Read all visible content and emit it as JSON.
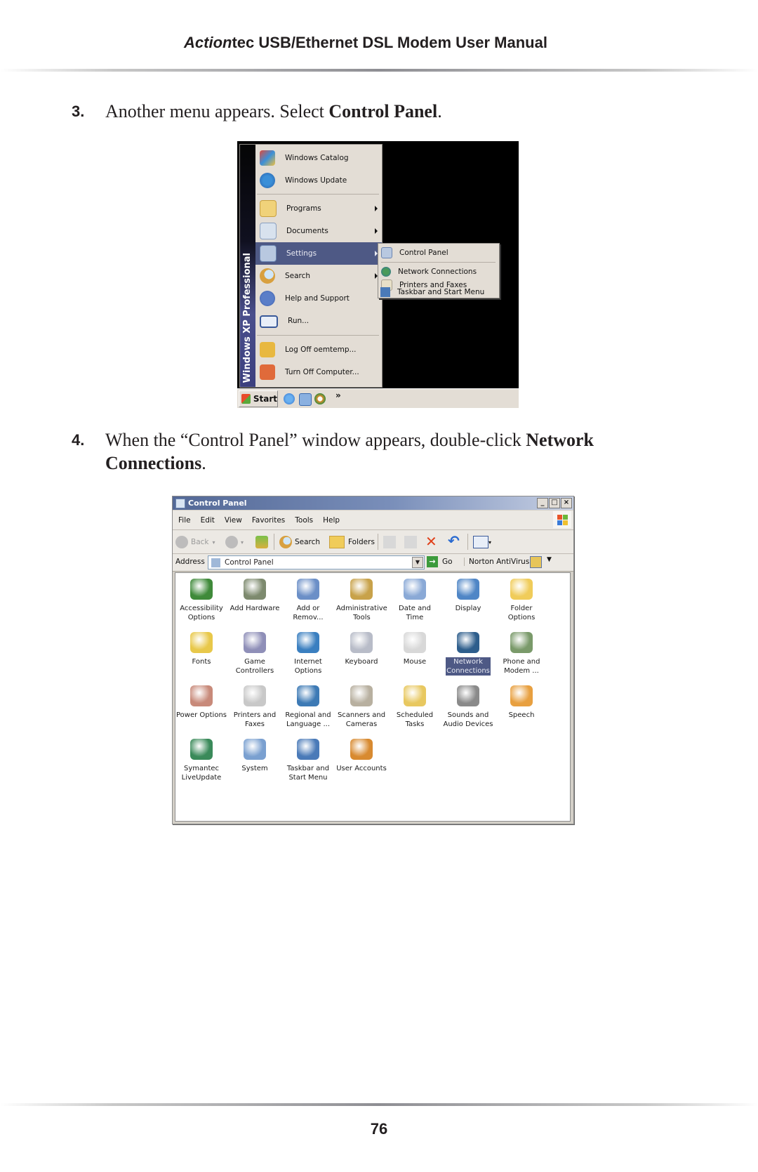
{
  "header": {
    "brand_italic": "Action",
    "title_rest": "tec USB/Ethernet DSL Modem User Manual"
  },
  "steps": [
    {
      "number": "3.",
      "text_before": "Another menu appears. Select ",
      "bold": "Control Panel",
      "text_after": "."
    },
    {
      "number": "4.",
      "text_before": "When the “Control Panel” window appears, double-click ",
      "bold": "Network Connections",
      "text_after": "."
    }
  ],
  "start_menu_screenshot": {
    "band_label": "Windows XP Professional",
    "items": [
      {
        "label": "Windows Catalog",
        "icon": "windows-catalog-icon",
        "submenu": false
      },
      {
        "label": "Windows Update",
        "icon": "windows-update-icon",
        "submenu": false
      },
      {
        "label": "Programs",
        "icon": "programs-icon",
        "submenu": true
      },
      {
        "label": "Documents",
        "icon": "documents-icon",
        "submenu": true
      },
      {
        "label": "Settings",
        "icon": "settings-icon",
        "submenu": true,
        "highlighted": true
      },
      {
        "label": "Search",
        "icon": "search-icon",
        "submenu": true
      },
      {
        "label": "Help and Support",
        "icon": "help-icon",
        "submenu": false
      },
      {
        "label": "Run...",
        "icon": "run-icon",
        "submenu": false
      },
      {
        "label": "Log Off oemtemp...",
        "icon": "log-off-icon",
        "submenu": false
      },
      {
        "label": "Turn Off Computer...",
        "icon": "power-icon",
        "submenu": false
      }
    ],
    "settings_submenu": [
      {
        "label": "Control Panel",
        "icon": "control-panel-icon"
      },
      {
        "label": "Network Connections",
        "icon": "network-connections-icon"
      },
      {
        "label": "Printers and Faxes",
        "icon": "printers-icon"
      },
      {
        "label": "Taskbar and Start Menu",
        "icon": "taskbar-icon"
      }
    ],
    "taskbar": {
      "start_label": "Start",
      "chevron": "»"
    }
  },
  "control_panel_screenshot": {
    "window_title": "Control Panel",
    "window_buttons": [
      "_",
      "□",
      "×"
    ],
    "menu": [
      "File",
      "Edit",
      "View",
      "Favorites",
      "Tools",
      "Help"
    ],
    "toolbar": {
      "back": "Back",
      "search": "Search",
      "folders": "Folders"
    },
    "address": {
      "label": "Address",
      "value": "Control Panel",
      "go": "Go",
      "norton": "Norton AntiVirus"
    },
    "items": [
      {
        "label": "Accessibility\nOptions",
        "color": "#3f8a3a"
      },
      {
        "label": "Add Hardware",
        "color": "#7d8a6e"
      },
      {
        "label": "Add or\nRemov...",
        "color": "#6b8fc7"
      },
      {
        "label": "Administrative\nTools",
        "color": "#c8a24a"
      },
      {
        "label": "Date and Time",
        "color": "#8aa9d6"
      },
      {
        "label": "Display",
        "color": "#4f86c6"
      },
      {
        "label": "Folder Options",
        "color": "#f0cc5a"
      },
      {
        "label": "Fonts",
        "color": "#e8c84a"
      },
      {
        "label": "Game\nControllers",
        "color": "#8f8fb8"
      },
      {
        "label": "Internet\nOptions",
        "color": "#3a7fc0"
      },
      {
        "label": "Keyboard",
        "color": "#b8bcc8"
      },
      {
        "label": "Mouse",
        "color": "#d8d8d8"
      },
      {
        "label": "Network\nConnections",
        "color": "#2e5e8c",
        "selected": true
      },
      {
        "label": "Phone and\nModem ...",
        "color": "#7a9a6a"
      },
      {
        "label": "Power Options",
        "color": "#c88a7a"
      },
      {
        "label": "Printers and\nFaxes",
        "color": "#c8c8c8"
      },
      {
        "label": "Regional and\nLanguage ...",
        "color": "#3d7ab5"
      },
      {
        "label": "Scanners and\nCameras",
        "color": "#b8b0a0"
      },
      {
        "label": "Scheduled\nTasks",
        "color": "#e8c860"
      },
      {
        "label": "Sounds and\nAudio Devices",
        "color": "#8a8a8a"
      },
      {
        "label": "Speech",
        "color": "#e8a040"
      },
      {
        "label": "Symantec\nLiveUpdate",
        "color": "#3a8a5a"
      },
      {
        "label": "System",
        "color": "#7aa0d0"
      },
      {
        "label": "Taskbar and\nStart Menu",
        "color": "#4a7ab8"
      },
      {
        "label": "User Accounts",
        "color": "#d88a30"
      }
    ]
  },
  "footer": {
    "page_number": "76"
  }
}
